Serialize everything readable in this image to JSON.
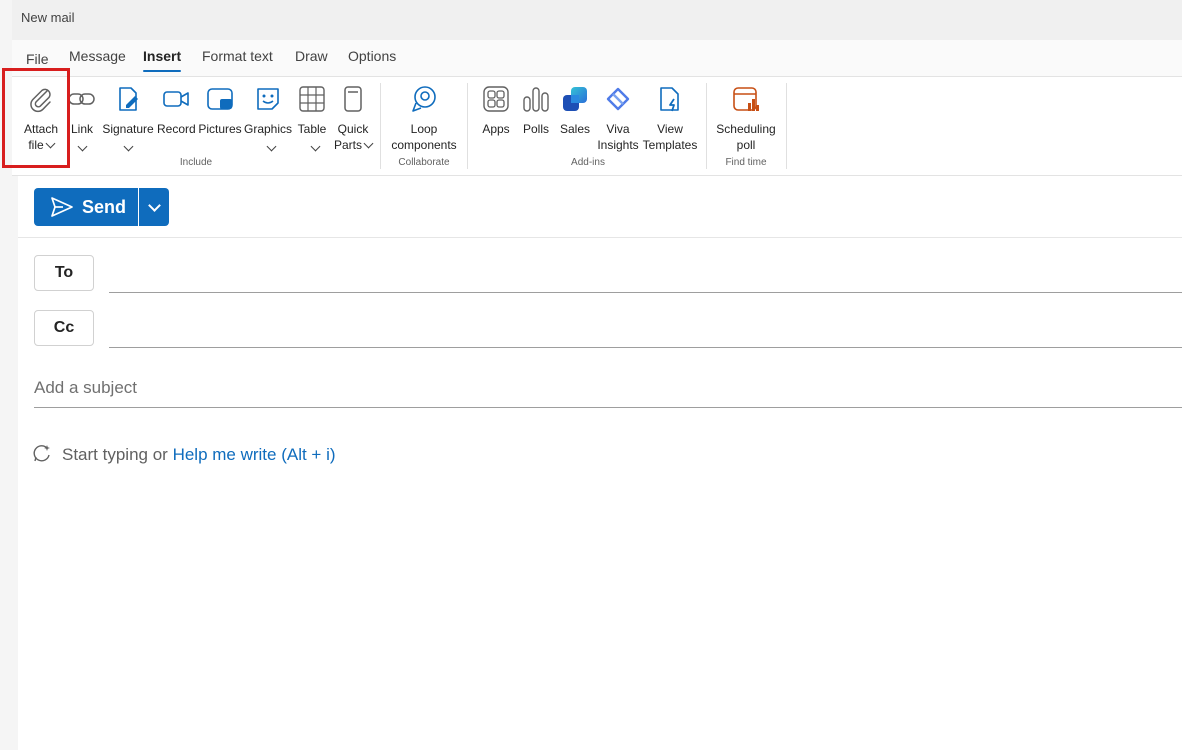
{
  "window": {
    "title": "New mail"
  },
  "menu": {
    "tabs": [
      "File",
      "Message",
      "Insert",
      "Format text",
      "Draw",
      "Options"
    ],
    "active": "Insert"
  },
  "ribbon": {
    "include": {
      "label": "Include",
      "attach": {
        "line1": "Attach",
        "line2": "file"
      },
      "link": "Link",
      "signature": "Signature",
      "record": "Record",
      "pictures": "Pictures",
      "graphics": "Graphics",
      "table": "Table",
      "quick_parts": {
        "line1": "Quick",
        "line2": "Parts"
      }
    },
    "collaborate": {
      "label": "Collaborate",
      "loop": {
        "line1": "Loop",
        "line2": "components"
      }
    },
    "addins": {
      "label": "Add-ins",
      "apps": "Apps",
      "polls": "Polls",
      "sales": "Sales",
      "viva": {
        "line1": "Viva",
        "line2": "Insights"
      },
      "templates": {
        "line1": "View",
        "line2": "Templates"
      }
    },
    "findtime": {
      "label": "Find time",
      "scheduling": {
        "line1": "Scheduling",
        "line2": "poll"
      }
    }
  },
  "compose": {
    "send_label": "Send",
    "to_label": "To",
    "cc_label": "Cc",
    "to_value": "",
    "cc_value": "",
    "subject_placeholder": "Add a subject",
    "body_prefix": "Start typing or ",
    "body_link": "Help me write (Alt + i)"
  },
  "colors": {
    "accent": "#0f6cbd",
    "highlight": "#d81e1e",
    "sales_gradient": [
      "#2b6fd8",
      "#34c3d6"
    ],
    "scheduling": "#c74f14"
  }
}
